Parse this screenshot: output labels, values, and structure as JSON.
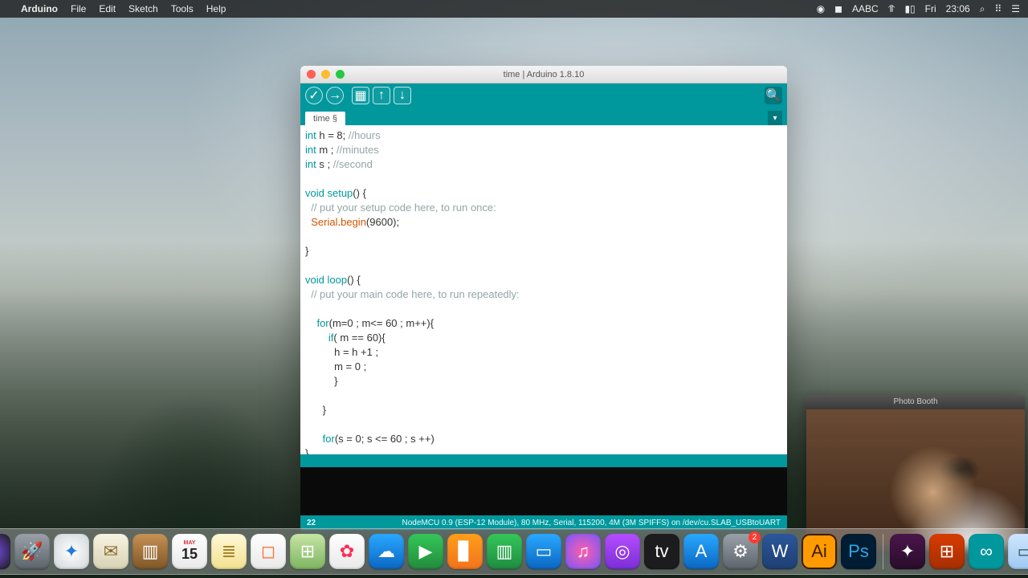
{
  "menubar": {
    "app": "Arduino",
    "items": [
      "File",
      "Edit",
      "Sketch",
      "Tools",
      "Help"
    ],
    "right": {
      "lang": "ABC",
      "day": "Fri",
      "time": "23:06"
    }
  },
  "arduino": {
    "title": "time | Arduino 1.8.10",
    "tab": "time §",
    "footer_line": "22",
    "footer_board": "NodeMCU 0.9 (ESP-12 Module), 80 MHz, Serial, 115200, 4M (3M SPIFFS) on /dev/cu.SLAB_USBtoUART",
    "code": {
      "l1a": "int",
      "l1b": " h = 8; ",
      "l1c": "//hours",
      "l2a": "int",
      "l2b": " m ; ",
      "l2c": "//minutes",
      "l3a": "int",
      "l3b": " s ; ",
      "l3c": "//second",
      "l4": "",
      "l5a": "void",
      "l5b": " ",
      "l5c": "setup",
      "l5d": "() {",
      "l6": "  // put your setup code here, to run once:",
      "l7a": "  ",
      "l7b": "Serial",
      "l7c": ".",
      "l7d": "begin",
      "l7e": "(9600);",
      "l8": "",
      "l9": "}",
      "l10": "",
      "l11a": "void",
      "l11b": " ",
      "l11c": "loop",
      "l11d": "() {",
      "l12": "  // put your main code here, to run repeatedly:",
      "l13": "",
      "l14a": "    ",
      "l14b": "for",
      "l14c": "(m=0 ; m<= 60 ; m++){",
      "l15a": "        ",
      "l15b": "if",
      "l15c": "( m == 60){",
      "l16": "          h = h +1 ;",
      "l17": "          m = 0 ;",
      "l18": "          }",
      "l19": "        ",
      "l20": "      }",
      "l21": "",
      "l22a": "      ",
      "l22b": "for",
      "l22c": "(s = 0; s <= 60 ; s ++)",
      "l23": "}"
    }
  },
  "photobooth": {
    "title": "Photo Booth"
  },
  "dock": {
    "apps": [
      {
        "name": "finder",
        "glyph": "☻",
        "bg": "linear-gradient(135deg,#2aa9ff,#0a66c2)"
      },
      {
        "name": "siri",
        "glyph": "◉",
        "bg": "radial-gradient(circle,#7a4ef0,#1b1b1b)"
      },
      {
        "name": "launchpad",
        "glyph": "🚀",
        "bg": "linear-gradient(#9aa1a8,#5b636b)"
      },
      {
        "name": "safari",
        "glyph": "✦",
        "bg": "radial-gradient(circle,#fefefe,#cfd5d8)",
        "fg": "#1e7bd9"
      },
      {
        "name": "mail",
        "glyph": "✉︎",
        "bg": "linear-gradient(#f7f4e2,#d8d2b4)",
        "fg": "#8a6b2b"
      },
      {
        "name": "contacts",
        "glyph": "▥",
        "bg": "linear-gradient(#c79255,#7e5626)"
      },
      {
        "name": "calendar",
        "glyph": "15",
        "bg": "linear-gradient(#fefefe,#e9e9e9)",
        "fg": "#222",
        "sub": "MAY"
      },
      {
        "name": "notes",
        "glyph": "≣",
        "bg": "linear-gradient(#fff8d6,#f2e190)",
        "fg": "#a9852c"
      },
      {
        "name": "reminders",
        "glyph": "◻︎",
        "bg": "linear-gradient(#fefefe,#e9e9e9)",
        "fg": "#ff6b2d"
      },
      {
        "name": "maps",
        "glyph": "⊞",
        "bg": "linear-gradient(#c7e5a5,#7db561)"
      },
      {
        "name": "photos",
        "glyph": "✿",
        "bg": "linear-gradient(#fefefe,#e9e9e9)",
        "fg": "#ff2d55"
      },
      {
        "name": "messages",
        "glyph": "☁︎",
        "bg": "linear-gradient(#2aa9ff,#0a66c2)"
      },
      {
        "name": "facetime",
        "glyph": "▶︎",
        "bg": "linear-gradient(#34c759,#248a3d)"
      },
      {
        "name": "books",
        "glyph": "▊",
        "bg": "linear-gradient(#ff9f1a,#f2731b)"
      },
      {
        "name": "numbers",
        "glyph": "▥",
        "bg": "linear-gradient(#34c759,#1e8b40)"
      },
      {
        "name": "keynote",
        "glyph": "▭",
        "bg": "linear-gradient(#2aa9ff,#0a66c2)"
      },
      {
        "name": "itunes",
        "glyph": "♫",
        "bg": "radial-gradient(circle,#ff5ea8,#7357ff)"
      },
      {
        "name": "podcasts",
        "glyph": "◎",
        "bg": "linear-gradient(#b44dff,#7b2ed6)"
      },
      {
        "name": "tv",
        "glyph": "tv",
        "bg": "#1c1c1e"
      },
      {
        "name": "appstore",
        "glyph": "A",
        "bg": "linear-gradient(#2aa9ff,#0a66c2)"
      },
      {
        "name": "sysprefs",
        "glyph": "⚙︎",
        "bg": "linear-gradient(#9aa1a8,#5b636b)",
        "badge": "2"
      },
      {
        "name": "word",
        "glyph": "W",
        "bg": "linear-gradient(#2b579a,#1e3f73)"
      },
      {
        "name": "illustrator",
        "glyph": "Ai",
        "bg": "#ff9a00",
        "fg": "#3a1b00",
        "outline": "#3a1b00"
      },
      {
        "name": "photoshop",
        "glyph": "Ps",
        "bg": "#001d34",
        "fg": "#2ea7e0"
      },
      {
        "name": "sep",
        "sep": true
      },
      {
        "name": "slack",
        "glyph": "✦",
        "bg": "linear-gradient(#4a154b,#2a0c2b)"
      },
      {
        "name": "office",
        "glyph": "⊞",
        "bg": "linear-gradient(#d83b01,#a52e01)"
      },
      {
        "name": "arduino",
        "glyph": "∞",
        "bg": "#00979d"
      },
      {
        "name": "preview",
        "glyph": "▭",
        "bg": "linear-gradient(#cfe6ff,#9dc9f2)",
        "fg": "#355"
      },
      {
        "name": "sep2",
        "sep": true
      },
      {
        "name": "trash",
        "glyph": "🗑",
        "bg": "rgba(255,255,255,.25)"
      }
    ]
  }
}
